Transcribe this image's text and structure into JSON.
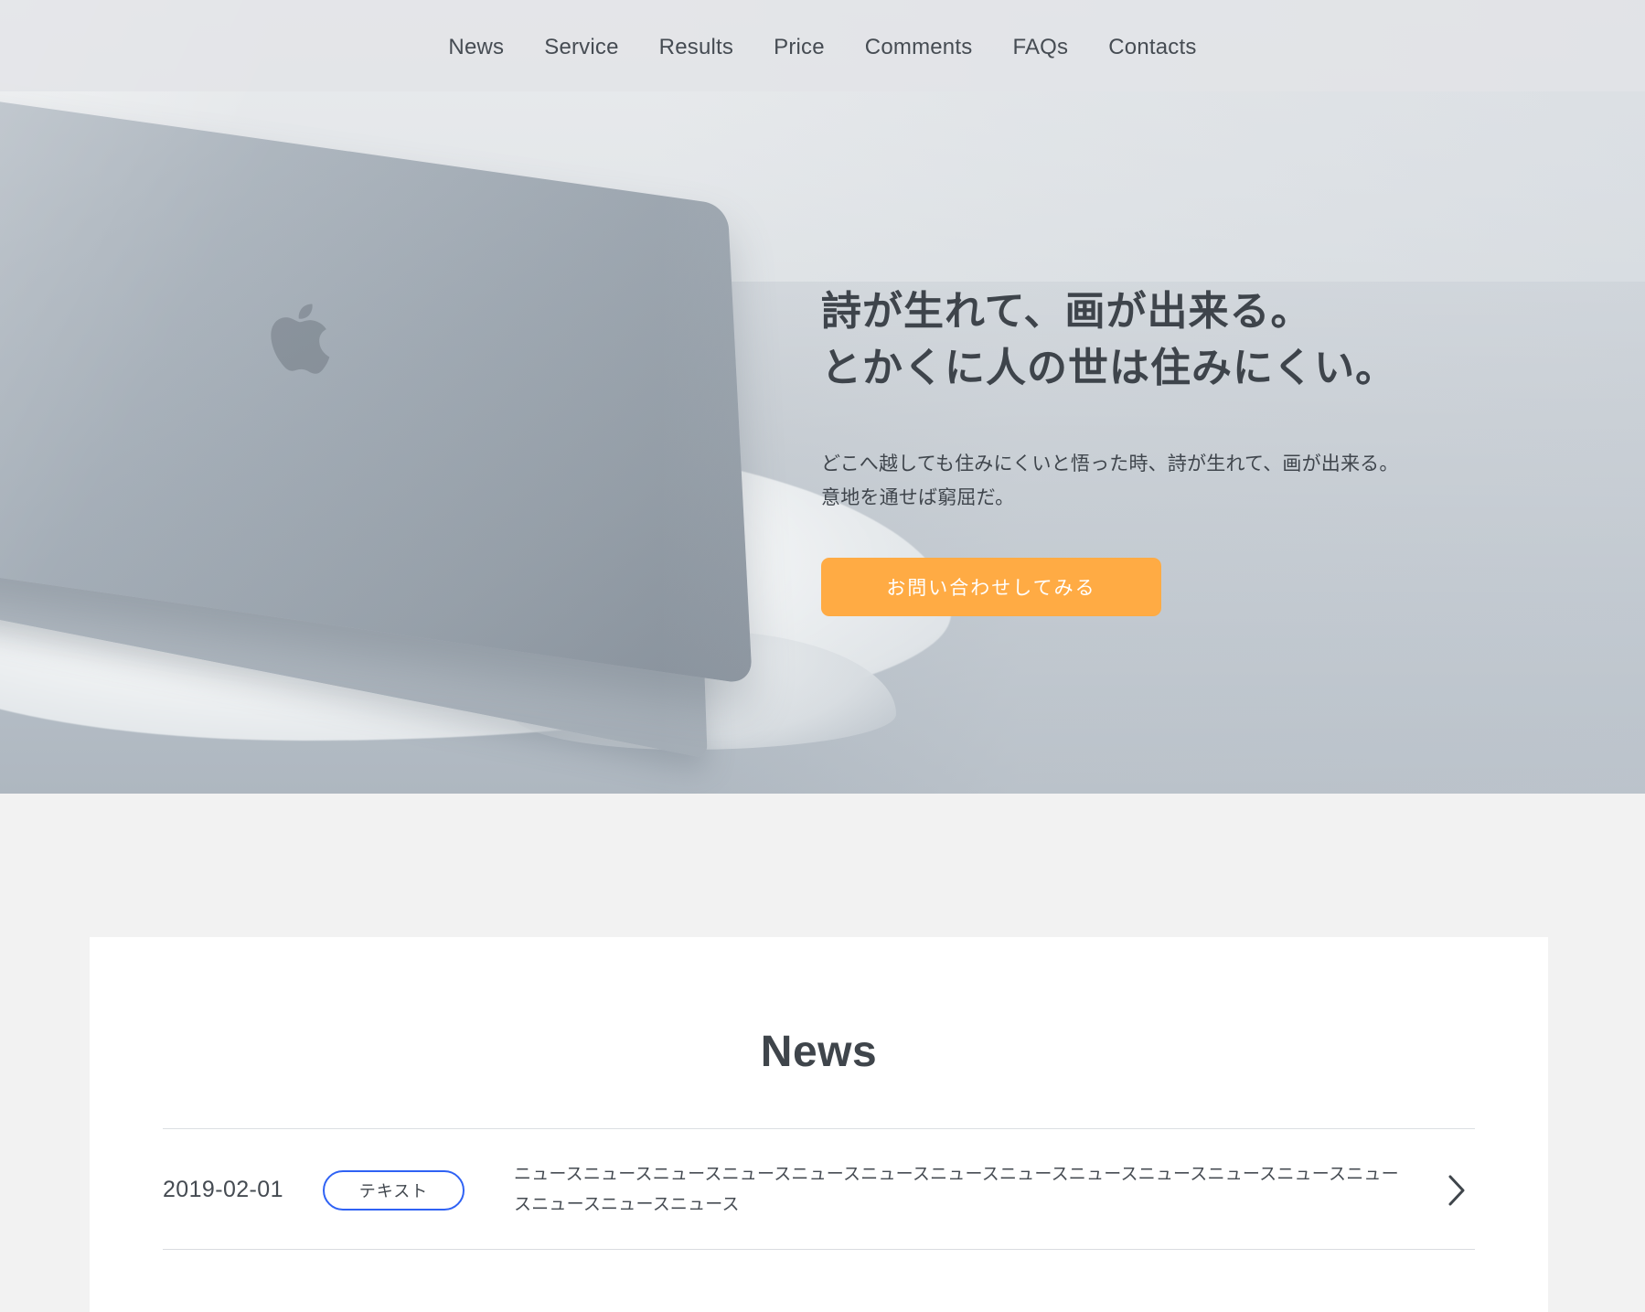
{
  "nav": {
    "items": [
      {
        "label": "News"
      },
      {
        "label": "Service"
      },
      {
        "label": "Results"
      },
      {
        "label": "Price"
      },
      {
        "label": "Comments"
      },
      {
        "label": "FAQs"
      },
      {
        "label": "Contacts"
      }
    ]
  },
  "hero": {
    "title_line1": "詩が生れて、画が出来る。",
    "title_line2": "とかくに人の世は住みにくい。",
    "desc_line1": "どこへ越しても住みにくいと悟った時、詩が生れて、画が出来る。",
    "desc_line2": "意地を通せば窮屈だ。",
    "cta_label": "お問い合わせしてみる",
    "cta_color": "#ffab44",
    "image_alt": "laptop-photo"
  },
  "news": {
    "heading": "News",
    "rows": [
      {
        "date": "2019-02-01",
        "tag": "テキスト",
        "text": "ニュースニュースニュースニュースニュースニュースニュースニュースニュースニュースニュースニュースニュースニュースニュースニュース",
        "chevron": "chevron-right-icon"
      }
    ]
  },
  "colors": {
    "accent_orange": "#ffab44",
    "tag_border_blue": "#2f62f4",
    "text_dark": "#3f454b",
    "page_bg": "#f2f2f2",
    "card_bg": "#ffffff",
    "nav_bg": "#e2e4e7"
  }
}
